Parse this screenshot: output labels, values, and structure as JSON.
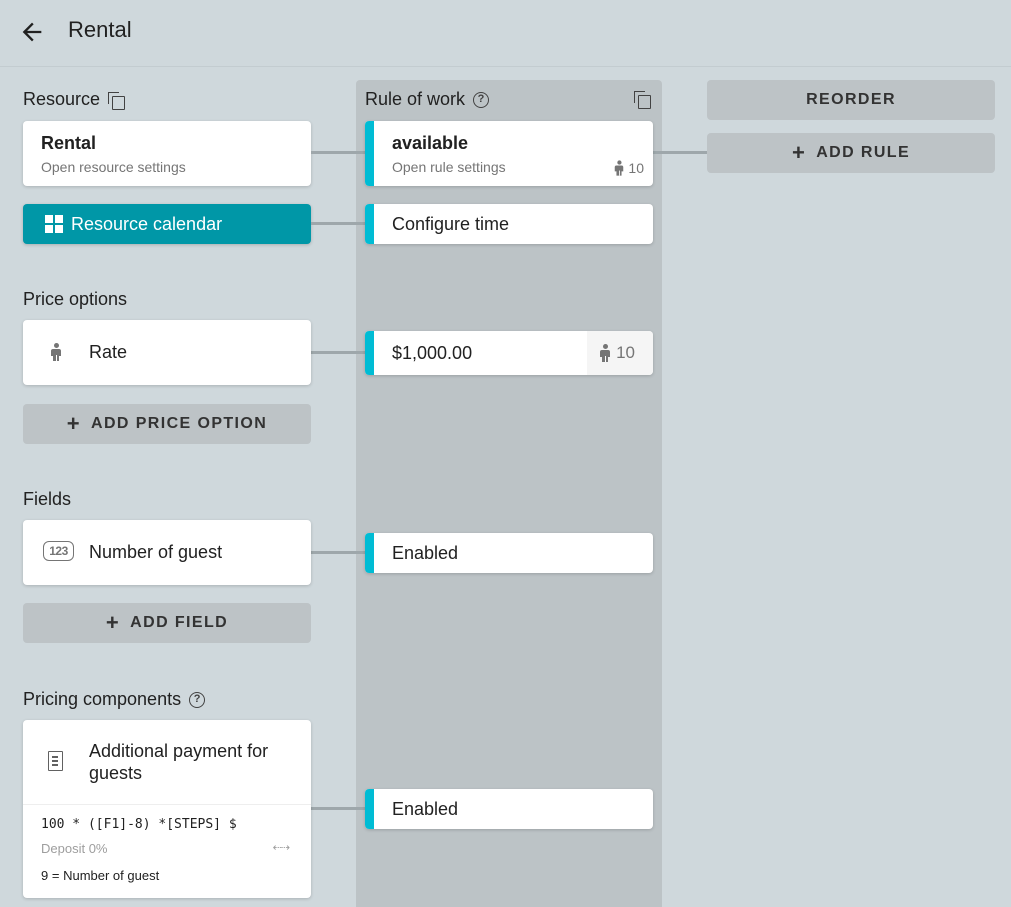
{
  "header": {
    "title": "Rental"
  },
  "resource": {
    "label": "Resource",
    "card_title": "Rental",
    "card_sub": "Open resource settings",
    "calendar_button": "Resource calendar"
  },
  "rules": {
    "label": "Rule of work",
    "rule_title": "available",
    "rule_sub": "Open rule settings",
    "rule_count": "10",
    "configure_time": "Configure time",
    "price_value": "$1,000.00",
    "price_count": "10",
    "field_status": "Enabled",
    "component_status": "Enabled"
  },
  "actions": {
    "reorder": "REORDER",
    "add_rule": "ADD RULE"
  },
  "price_options": {
    "label": "Price options",
    "item_label": "Rate",
    "add_button": "ADD PRICE OPTION"
  },
  "fields": {
    "label": "Fields",
    "item_icon_text": "123",
    "item_label": "Number of guest",
    "add_button": "ADD FIELD"
  },
  "pricing_components": {
    "label": "Pricing components",
    "item_title": "Additional payment for guests",
    "formula": "100 * ([F1]-8) *[STEPS] $",
    "deposit": "Deposit 0%",
    "var_num": "9",
    "var_eq": "=",
    "var_label": "Number of guest"
  }
}
